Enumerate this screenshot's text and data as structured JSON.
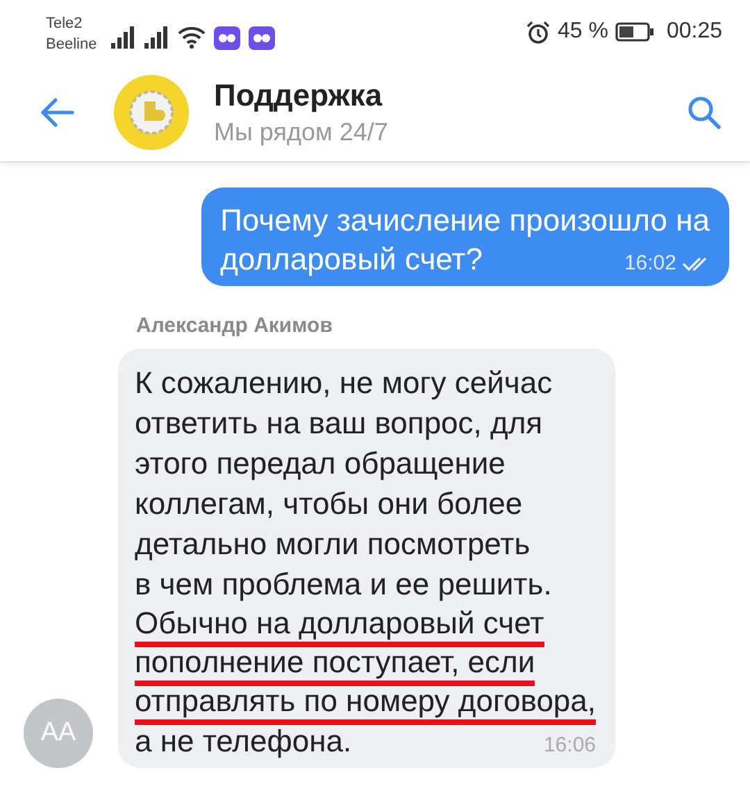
{
  "status_bar": {
    "carriers": [
      "Tele2",
      "Beeline"
    ],
    "battery": "45 %",
    "time": "00:25"
  },
  "header": {
    "title": "Поддержка",
    "subtitle": "Мы рядом 24/7"
  },
  "messages": [
    {
      "kind": "outgoing",
      "lines": [
        {
          "text": "Почему зачисление произошло на",
          "underlined": false
        },
        {
          "text": "долларовый счет?",
          "underlined": false
        }
      ],
      "time": "16:02",
      "read": true
    },
    {
      "kind": "incoming",
      "sender": "Александр Акимов",
      "avatar": "АА",
      "lines": [
        {
          "text": "К сожалению, не могу сейчас",
          "underlined": false
        },
        {
          "text": "ответить на ваш вопрос, для",
          "underlined": false
        },
        {
          "text": "этого передал обращение",
          "underlined": false
        },
        {
          "text": "коллегам, чтобы они более",
          "underlined": false
        },
        {
          "text": "детально могли посмотреть",
          "underlined": false
        },
        {
          "text": "в чем проблема и ее решить.",
          "underlined": false
        },
        {
          "text": "Обычно на долларовый счет",
          "underlined": true
        },
        {
          "text": "пополнение поступает, если",
          "underlined": true
        },
        {
          "text": "отправлять по номеру договора,",
          "underlined": true
        },
        {
          "text": "а не телефона.",
          "underlined": false
        }
      ],
      "time": "16:06"
    }
  ]
}
